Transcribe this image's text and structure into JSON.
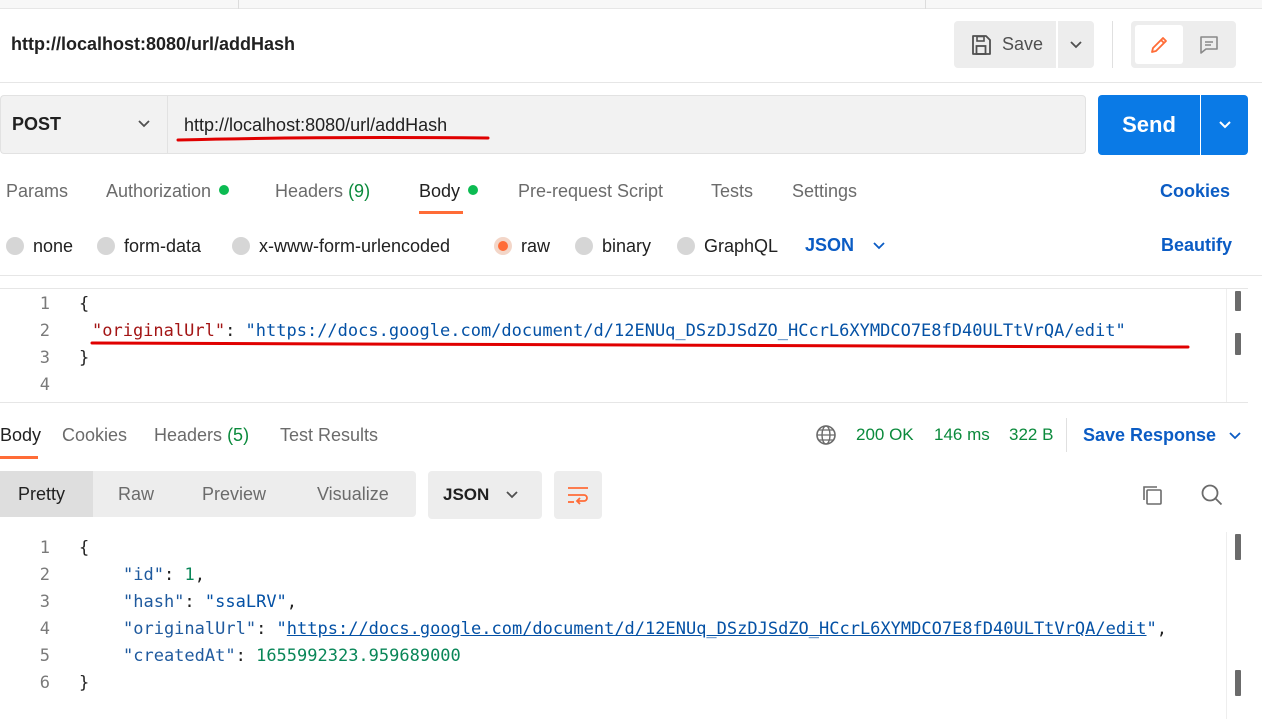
{
  "header": {
    "title": "http://localhost:8080/url/addHash",
    "save_label": "Save"
  },
  "request": {
    "method": "POST",
    "url": "http://localhost:8080/url/addHash",
    "send_label": "Send",
    "tabs": [
      {
        "label": "Params"
      },
      {
        "label": "Authorization"
      },
      {
        "label": "Headers",
        "count": "(9)"
      },
      {
        "label": "Body"
      },
      {
        "label": "Pre-request Script"
      },
      {
        "label": "Tests"
      },
      {
        "label": "Settings"
      }
    ],
    "cookies_label": "Cookies",
    "body_types": [
      "none",
      "form-data",
      "x-www-form-urlencoded",
      "raw",
      "binary",
      "GraphQL"
    ],
    "selected_body_type": "raw",
    "language": "JSON",
    "beautify_label": "Beautify",
    "editor_lines": [
      "1",
      "2",
      "3",
      "4"
    ],
    "body_code": {
      "open": "{",
      "key": "\"originalUrl\"",
      "colon": ": ",
      "value": "\"https://docs.google.com/document/d/12ENUq_DSzDJSdZO_HCcrL6XYMDCO7E8fD40ULTtVrQA/edit\"",
      "close": "}"
    }
  },
  "response": {
    "tabs": [
      {
        "label": "Body"
      },
      {
        "label": "Cookies"
      },
      {
        "label": "Headers",
        "count": "(5)"
      },
      {
        "label": "Test Results"
      }
    ],
    "status": "200 OK",
    "time": "146 ms",
    "size": "322 B",
    "save_response_label": "Save Response",
    "view_tabs": [
      "Pretty",
      "Raw",
      "Preview",
      "Visualize"
    ],
    "format": "JSON",
    "editor_lines": [
      "1",
      "2",
      "3",
      "4",
      "5",
      "6"
    ],
    "json": {
      "open": "{",
      "id_key": "\"id\"",
      "id_value": "1",
      "hash_key": "\"hash\"",
      "hash_value": "\"ssaLRV\"",
      "url_key": "\"originalUrl\"",
      "url_value": "https://docs.google.com/document/d/12ENUq_DSzDJSdZO_HCcrL6XYMDCO7E8fD40ULTtVrQA/edit",
      "created_key": "\"createdAt\"",
      "created_value": "1655992323.959689000",
      "close": "}"
    }
  },
  "colors": {
    "accent": "#ff6c37",
    "send": "#0a7ae6",
    "link": "#0b5cc4",
    "success": "#0b8a3c",
    "annotation": "#e00000"
  }
}
